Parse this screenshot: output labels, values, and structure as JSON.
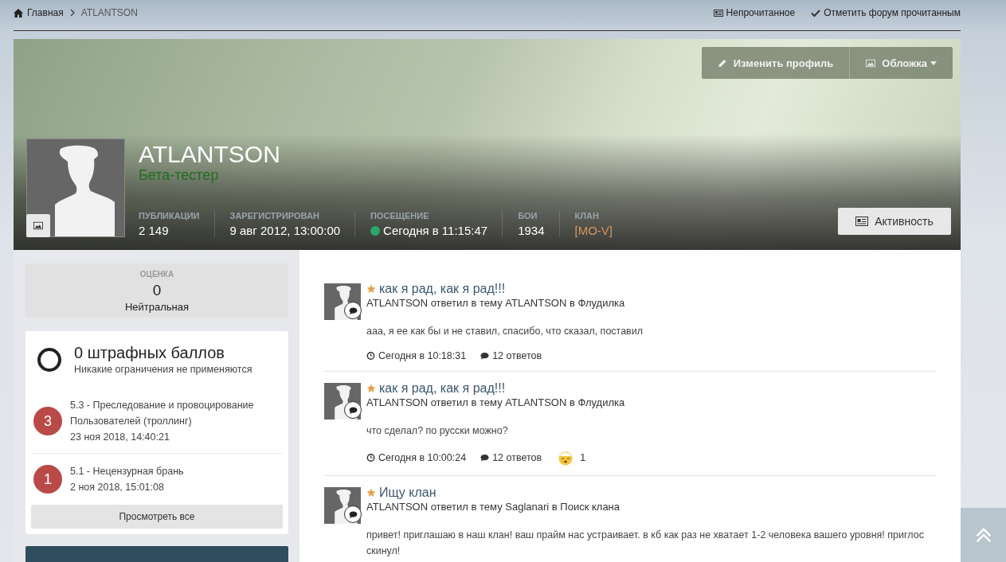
{
  "breadcrumb": [
    {
      "label": "Главная",
      "kind": "home"
    },
    {
      "label": "ATLANTSON",
      "kind": "current"
    }
  ],
  "top_links": [
    {
      "label": "Непрочитанное",
      "kind": "unread"
    },
    {
      "label": "Отметить форум прочитанным",
      "kind": "check"
    }
  ],
  "cover_buttons": [
    {
      "label": "Изменить профиль",
      "kind": "edit"
    },
    {
      "label": "Обложка",
      "kind": "image"
    }
  ],
  "profile": {
    "name": "ATLANTSON",
    "group": "Бета-тестер",
    "activity_button": "Активность"
  },
  "stats": [
    {
      "label": "ПУБЛИКАЦИИ",
      "value": "2 149",
      "kind": "plain"
    },
    {
      "label": "ЗАРЕГИСТРИРОВАН",
      "value": "9 авг 2012, 13:00:00",
      "kind": "plain"
    },
    {
      "label": "ПОСЕЩЕНИЕ",
      "value": "Сегодня в 11:15:47",
      "kind": "online"
    },
    {
      "label": "БОИ",
      "value": "1934",
      "kind": "plain"
    },
    {
      "label": "КЛАН",
      "value": "[MO-V]",
      "kind": "clan"
    }
  ],
  "rating": {
    "label": "ОЦЕНКА",
    "value": "0",
    "text": "Нейтральная"
  },
  "penalties": {
    "title": "0 штрафных баллов",
    "subtitle": "Никакие ограничения не применяются",
    "view_all": "Просмотреть все",
    "items": [
      {
        "points": "3",
        "color": "#b94a48",
        "reason": "5.3 - Преследование и провоцирование Пользователей (троллинг)",
        "date": "23 ноя 2018, 14:40:21"
      },
      {
        "points": "1",
        "color": "#b94a48",
        "reason": "5.1 - Нецензурная брань",
        "date": "2 ноя 2018, 15:01:08"
      }
    ]
  },
  "feed": [
    {
      "title": "как я рад, как я рад!!!",
      "subtitle": "ATLANTSON ответил в тему ATLANTSON в Флудилка",
      "body": "ааа, я ее как бы и не ставил, спасибо, что сказал, поставил",
      "time": "Сегодня в 10:18:31",
      "replies": "12 ответов"
    },
    {
      "title": "как я рад, как я рад!!!",
      "subtitle": "ATLANTSON ответил в тему ATLANTSON в Флудилка",
      "body": "что сделал? по русски можно?",
      "time": "Сегодня в 10:00:24",
      "replies": "12 ответов",
      "reactions": "1"
    },
    {
      "title": "Ищу клан",
      "subtitle": "ATLANTSON ответил в тему Saglanari в Поиск клана",
      "body": "привет! приглашаю в наш клан! ваш прайм нас устраивает. в кб как раз не хватает 1-2 человека вашего уровня! приглос скинул!"
    }
  ]
}
